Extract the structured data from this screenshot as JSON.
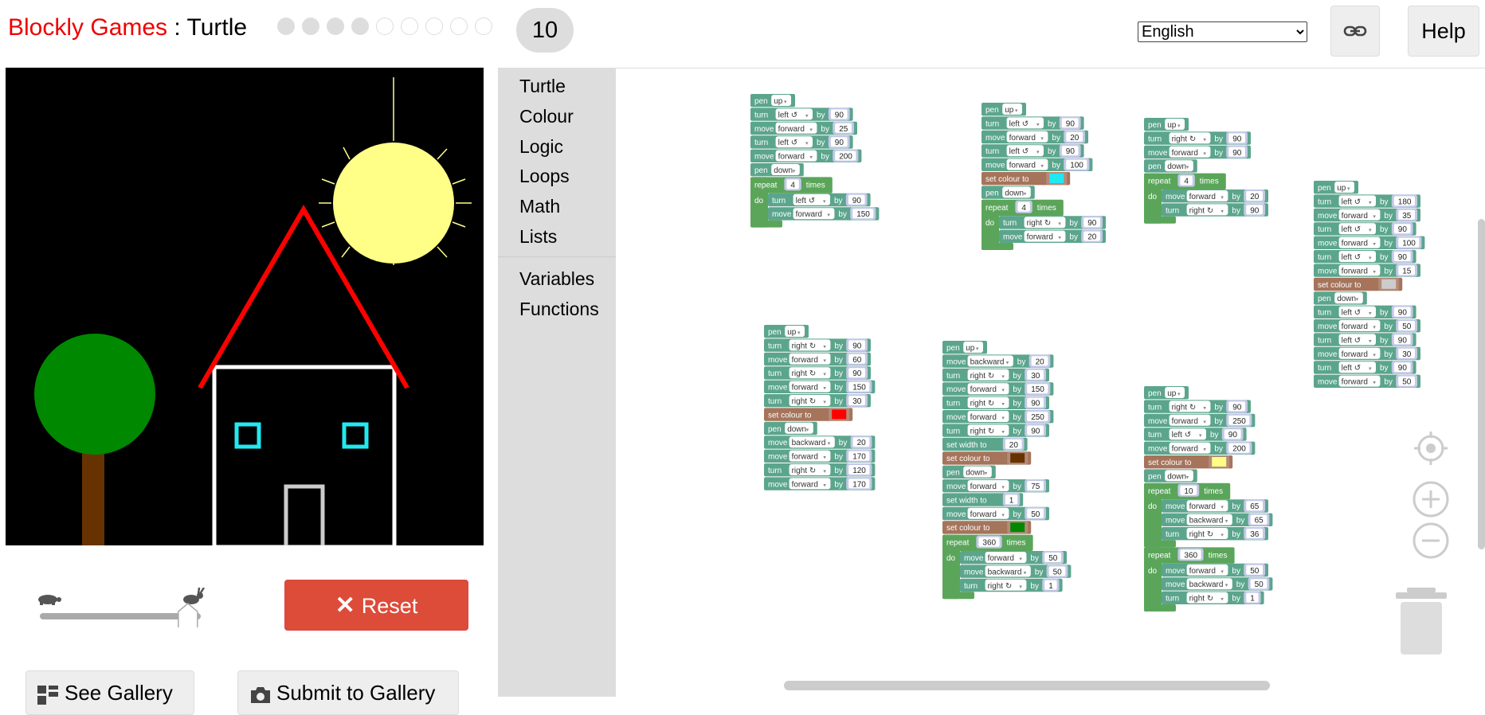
{
  "header": {
    "brand": "Blockly Games",
    "separator": " : ",
    "game": "Turtle",
    "levels_done": 4,
    "levels_total": 9,
    "current_level": "10",
    "language": "English",
    "help_label": "Help"
  },
  "controls": {
    "reset_label": "Reset",
    "gallery_label": "See Gallery",
    "submit_label": "Submit to Gallery",
    "speed_fraction": 0.92
  },
  "toolbox": {
    "categories": [
      "Turtle",
      "Colour",
      "Logic",
      "Loops",
      "Math",
      "Lists"
    ],
    "categories2": [
      "Variables",
      "Functions"
    ]
  },
  "colors": {
    "turtle_block": "#5ba58c",
    "colour_block": "#a5745b",
    "loop_block": "#5ba55b",
    "reset": "#dd4b39",
    "brand": "#ee0000"
  },
  "block_groups": [
    {
      "blocks": [
        {
          "t": "pen",
          "a": "up"
        },
        {
          "t": "turn",
          "a": "left ↺",
          "n": "90"
        },
        {
          "t": "move",
          "a": "forward",
          "n": "25"
        },
        {
          "t": "turn",
          "a": "left ↺",
          "n": "90"
        },
        {
          "t": "move",
          "a": "forward",
          "n": "200"
        },
        {
          "t": "pen",
          "a": "down"
        },
        {
          "t": "repeat",
          "n": "4",
          "body": [
            {
              "t": "turn",
              "a": "left ↺",
              "n": "90"
            },
            {
              "t": "move",
              "a": "forward",
              "n": "150"
            }
          ]
        }
      ]
    },
    {
      "blocks": [
        {
          "t": "pen",
          "a": "up"
        },
        {
          "t": "turn",
          "a": "left ↺",
          "n": "90"
        },
        {
          "t": "move",
          "a": "forward",
          "n": "20"
        },
        {
          "t": "turn",
          "a": "left ↺",
          "n": "90"
        },
        {
          "t": "move",
          "a": "forward",
          "n": "100"
        },
        {
          "t": "colour",
          "c": "#22e8f0"
        },
        {
          "t": "pen",
          "a": "down"
        },
        {
          "t": "repeat",
          "n": "4",
          "body": [
            {
              "t": "turn",
              "a": "right ↻",
              "n": "90"
            },
            {
              "t": "move",
              "a": "forward",
              "n": "20"
            }
          ]
        }
      ]
    },
    {
      "blocks": [
        {
          "t": "pen",
          "a": "up"
        },
        {
          "t": "turn",
          "a": "right ↻",
          "n": "90"
        },
        {
          "t": "move",
          "a": "forward",
          "n": "90"
        },
        {
          "t": "pen",
          "a": "down"
        },
        {
          "t": "repeat",
          "n": "4",
          "body": [
            {
              "t": "move",
              "a": "forward",
              "n": "20"
            },
            {
              "t": "turn",
              "a": "right ↻",
              "n": "90"
            }
          ]
        }
      ]
    },
    {
      "blocks": [
        {
          "t": "pen",
          "a": "up"
        },
        {
          "t": "turn",
          "a": "left ↺",
          "n": "180"
        },
        {
          "t": "move",
          "a": "forward",
          "n": "35"
        },
        {
          "t": "turn",
          "a": "left ↺",
          "n": "90"
        },
        {
          "t": "move",
          "a": "forward",
          "n": "100"
        },
        {
          "t": "turn",
          "a": "left ↺",
          "n": "90"
        },
        {
          "t": "move",
          "a": "forward",
          "n": "15"
        },
        {
          "t": "colour",
          "c": "#cccccc"
        },
        {
          "t": "pen",
          "a": "down"
        },
        {
          "t": "turn",
          "a": "left ↺",
          "n": "90"
        },
        {
          "t": "move",
          "a": "forward",
          "n": "50"
        },
        {
          "t": "turn",
          "a": "left ↺",
          "n": "90"
        },
        {
          "t": "move",
          "a": "forward",
          "n": "30"
        },
        {
          "t": "turn",
          "a": "left ↺",
          "n": "90"
        },
        {
          "t": "move",
          "a": "forward",
          "n": "50"
        }
      ]
    },
    {
      "blocks": [
        {
          "t": "pen",
          "a": "up"
        },
        {
          "t": "turn",
          "a": "right ↻",
          "n": "90"
        },
        {
          "t": "move",
          "a": "forward",
          "n": "60"
        },
        {
          "t": "turn",
          "a": "right ↻",
          "n": "90"
        },
        {
          "t": "move",
          "a": "forward",
          "n": "150"
        },
        {
          "t": "turn",
          "a": "right ↻",
          "n": "30"
        },
        {
          "t": "colour",
          "c": "#ff0000"
        },
        {
          "t": "pen",
          "a": "down"
        },
        {
          "t": "move",
          "a": "backward",
          "n": "20"
        },
        {
          "t": "move",
          "a": "forward",
          "n": "170"
        },
        {
          "t": "turn",
          "a": "right ↻",
          "n": "120"
        },
        {
          "t": "move",
          "a": "forward",
          "n": "170"
        }
      ]
    },
    {
      "blocks": [
        {
          "t": "pen",
          "a": "up"
        },
        {
          "t": "move",
          "a": "backward",
          "n": "20"
        },
        {
          "t": "turn",
          "a": "right ↻",
          "n": "30"
        },
        {
          "t": "move",
          "a": "forward",
          "n": "150"
        },
        {
          "t": "turn",
          "a": "right ↻",
          "n": "90"
        },
        {
          "t": "move",
          "a": "forward",
          "n": "250"
        },
        {
          "t": "turn",
          "a": "right ↻",
          "n": "90"
        },
        {
          "t": "width",
          "n": "20"
        },
        {
          "t": "colour",
          "c": "#663300"
        },
        {
          "t": "pen",
          "a": "down"
        },
        {
          "t": "move",
          "a": "forward",
          "n": "75"
        },
        {
          "t": "width",
          "n": "1"
        },
        {
          "t": "move",
          "a": "forward",
          "n": "50"
        },
        {
          "t": "colour",
          "c": "#008800"
        },
        {
          "t": "repeat",
          "n": "360",
          "body": [
            {
              "t": "move",
              "a": "forward",
              "n": "50"
            },
            {
              "t": "move",
              "a": "backward",
              "n": "50"
            },
            {
              "t": "turn",
              "a": "right ↻",
              "n": "1"
            }
          ]
        }
      ]
    },
    {
      "blocks": [
        {
          "t": "pen",
          "a": "up"
        },
        {
          "t": "turn",
          "a": "right ↻",
          "n": "90"
        },
        {
          "t": "move",
          "a": "forward",
          "n": "250"
        },
        {
          "t": "turn",
          "a": "left ↺",
          "n": "90"
        },
        {
          "t": "move",
          "a": "forward",
          "n": "200"
        },
        {
          "t": "colour",
          "c": "#ffff88"
        },
        {
          "t": "pen",
          "a": "down"
        },
        {
          "t": "repeat",
          "n": "10",
          "body": [
            {
              "t": "move",
              "a": "forward",
              "n": "65"
            },
            {
              "t": "move",
              "a": "backward",
              "n": "65"
            },
            {
              "t": "turn",
              "a": "right ↻",
              "n": "36"
            }
          ]
        },
        {
          "t": "repeat",
          "n": "360",
          "body": [
            {
              "t": "move",
              "a": "forward",
              "n": "50"
            },
            {
              "t": "move",
              "a": "backward",
              "n": "50"
            },
            {
              "t": "turn",
              "a": "right ↻",
              "n": "1"
            }
          ]
        }
      ]
    }
  ],
  "block_words": {
    "by": "by",
    "times": "times",
    "do": "do",
    "set_colour": "set colour to",
    "set_width": "set width to"
  }
}
